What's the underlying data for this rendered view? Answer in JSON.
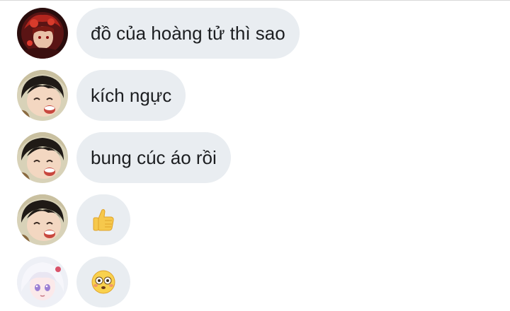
{
  "messages": [
    {
      "text": "đồ của hoàng tử thì sao",
      "avatar": "avatar-red-anime"
    },
    {
      "text": "kích ngực",
      "avatar": "avatar-smiling-boy"
    },
    {
      "text": "bung cúc áo rồi",
      "avatar": "avatar-smiling-boy"
    },
    {
      "emoji": "thumbs-up-icon",
      "avatar": "avatar-smiling-boy"
    },
    {
      "emoji": "flushed-face-icon",
      "avatar": "avatar-white-hair-girl"
    }
  ],
  "colors": {
    "bubble": "#e9edf1",
    "text": "#1c1e21",
    "background": "#ffffff"
  }
}
